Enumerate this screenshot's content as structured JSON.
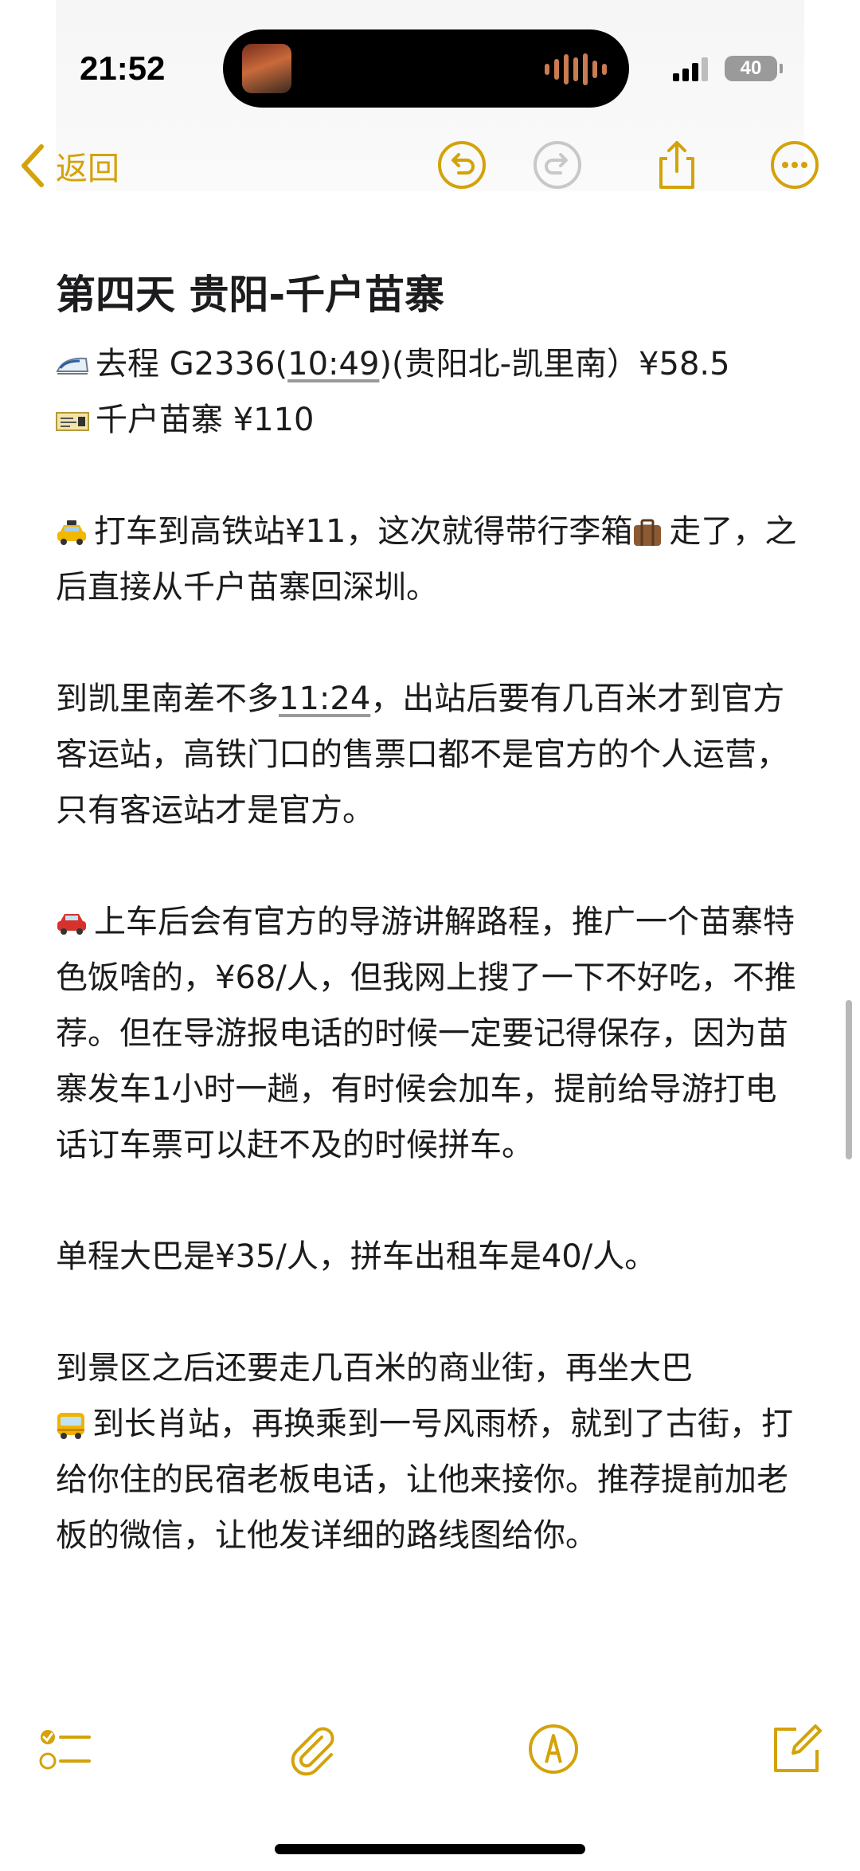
{
  "status_bar": {
    "time": "21:52",
    "battery": "40"
  },
  "toolbar": {
    "back_label": "返回"
  },
  "note": {
    "title": "第四天 贵阳-千户苗寨",
    "train_line": {
      "prefix": "去程 G2336(",
      "time": "10:49",
      "suffix": ")(贵阳北-凯里南）¥58.5"
    },
    "ticket_line": "千户苗寨 ¥110",
    "taxi": {
      "part1": "打车到高铁站¥11，这次就得带行李箱",
      "part2": "走了，之后直接从千户苗寨回深圳。"
    },
    "arrive": {
      "prefix": "到凯里南差不多",
      "time": "11:24",
      "suffix": "，出站后要有几百米才到官方客运站，高铁门口的售票口都不是官方的个人运营，只有客运站才是官方。"
    },
    "car": "上车后会有官方的导游讲解路程，推广一个苗寨特色饭啥的，¥68/人，但我网上搜了一下不好吃，不推荐。但在导游报电话的时候一定要记得保存，因为苗寨发车1小时一趟，有时候会加车，提前给导游打电话订车票可以赶不及的时候拼车。",
    "fare": "单程大巴是¥35/人，拼车出租车是40/人。",
    "scenic": {
      "part1": "到景区之后还要走几百米的商业街，再坐大巴",
      "part2": "到长肖站，再换乘到一号风雨桥，就到了古街，打给你住的民宿老板电话，让他来接你。推荐提前加老板的微信，让他发详细的路线图给你。"
    }
  },
  "icons": {
    "back": "chevron-left-icon",
    "undo": "undo-icon",
    "redo": "redo-icon",
    "share": "share-icon",
    "more": "more-icon",
    "checklist": "checklist-icon",
    "attach": "paperclip-icon",
    "markup": "markup-pen-icon",
    "compose": "compose-icon"
  },
  "colors": {
    "accent": "#d4a20a",
    "disabled": "#c8c8c8",
    "text": "#1c1c1e"
  }
}
